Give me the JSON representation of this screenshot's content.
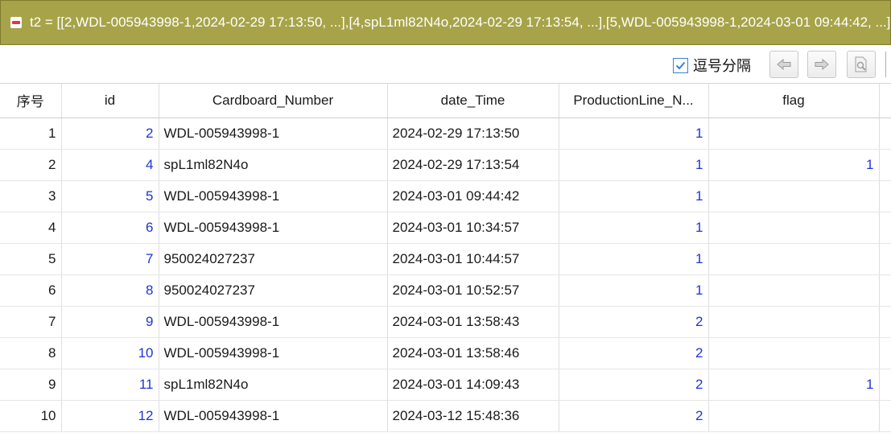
{
  "expression": {
    "text": "t2 = [[2,WDL-005943998-1,2024-02-29 17:13:50, ...],[4,spL1ml82N4o,2024-02-29 17:13:54, ...],[5,WDL-005943998-1,2024-03-01 09:44:42, ...]]"
  },
  "toolbar": {
    "comma_separator_label": "逗号分隔",
    "comma_separator_checked": true
  },
  "table": {
    "columns": [
      "序号",
      "id",
      "Cardboard_Number",
      "date_Time",
      "ProductionLine_N...",
      "flag"
    ],
    "rows": [
      {
        "seq": "1",
        "id": "2",
        "cardboard": "WDL-005943998-1",
        "datetime": "2024-02-29 17:13:50",
        "line": "1",
        "flag": ""
      },
      {
        "seq": "2",
        "id": "4",
        "cardboard": "spL1ml82N4o",
        "datetime": "2024-02-29 17:13:54",
        "line": "1",
        "flag": "1"
      },
      {
        "seq": "3",
        "id": "5",
        "cardboard": "WDL-005943998-1",
        "datetime": "2024-03-01 09:44:42",
        "line": "1",
        "flag": ""
      },
      {
        "seq": "4",
        "id": "6",
        "cardboard": "WDL-005943998-1",
        "datetime": "2024-03-01 10:34:57",
        "line": "1",
        "flag": ""
      },
      {
        "seq": "5",
        "id": "7",
        "cardboard": "950024027237",
        "datetime": "2024-03-01 10:44:57",
        "line": "1",
        "flag": ""
      },
      {
        "seq": "6",
        "id": "8",
        "cardboard": "950024027237",
        "datetime": "2024-03-01 10:52:57",
        "line": "1",
        "flag": ""
      },
      {
        "seq": "7",
        "id": "9",
        "cardboard": "WDL-005943998-1",
        "datetime": "2024-03-01 13:58:43",
        "line": "2",
        "flag": ""
      },
      {
        "seq": "8",
        "id": "10",
        "cardboard": "WDL-005943998-1",
        "datetime": "2024-03-01 13:58:46",
        "line": "2",
        "flag": ""
      },
      {
        "seq": "9",
        "id": "11",
        "cardboard": "spL1ml82N4o",
        "datetime": "2024-03-01 14:09:43",
        "line": "2",
        "flag": "1"
      },
      {
        "seq": "10",
        "id": "12",
        "cardboard": "WDL-005943998-1",
        "datetime": "2024-03-12 15:48:36",
        "line": "2",
        "flag": ""
      }
    ]
  },
  "icons": {
    "expression_toggle": "collapse-minus-icon",
    "prev": "arrow-left-icon",
    "next": "arrow-right-icon",
    "find": "find-page-icon"
  },
  "colors": {
    "header_bar": "#a7a349",
    "number_text": "#1f34d6",
    "checkbox_accent": "#3c7fd8"
  }
}
